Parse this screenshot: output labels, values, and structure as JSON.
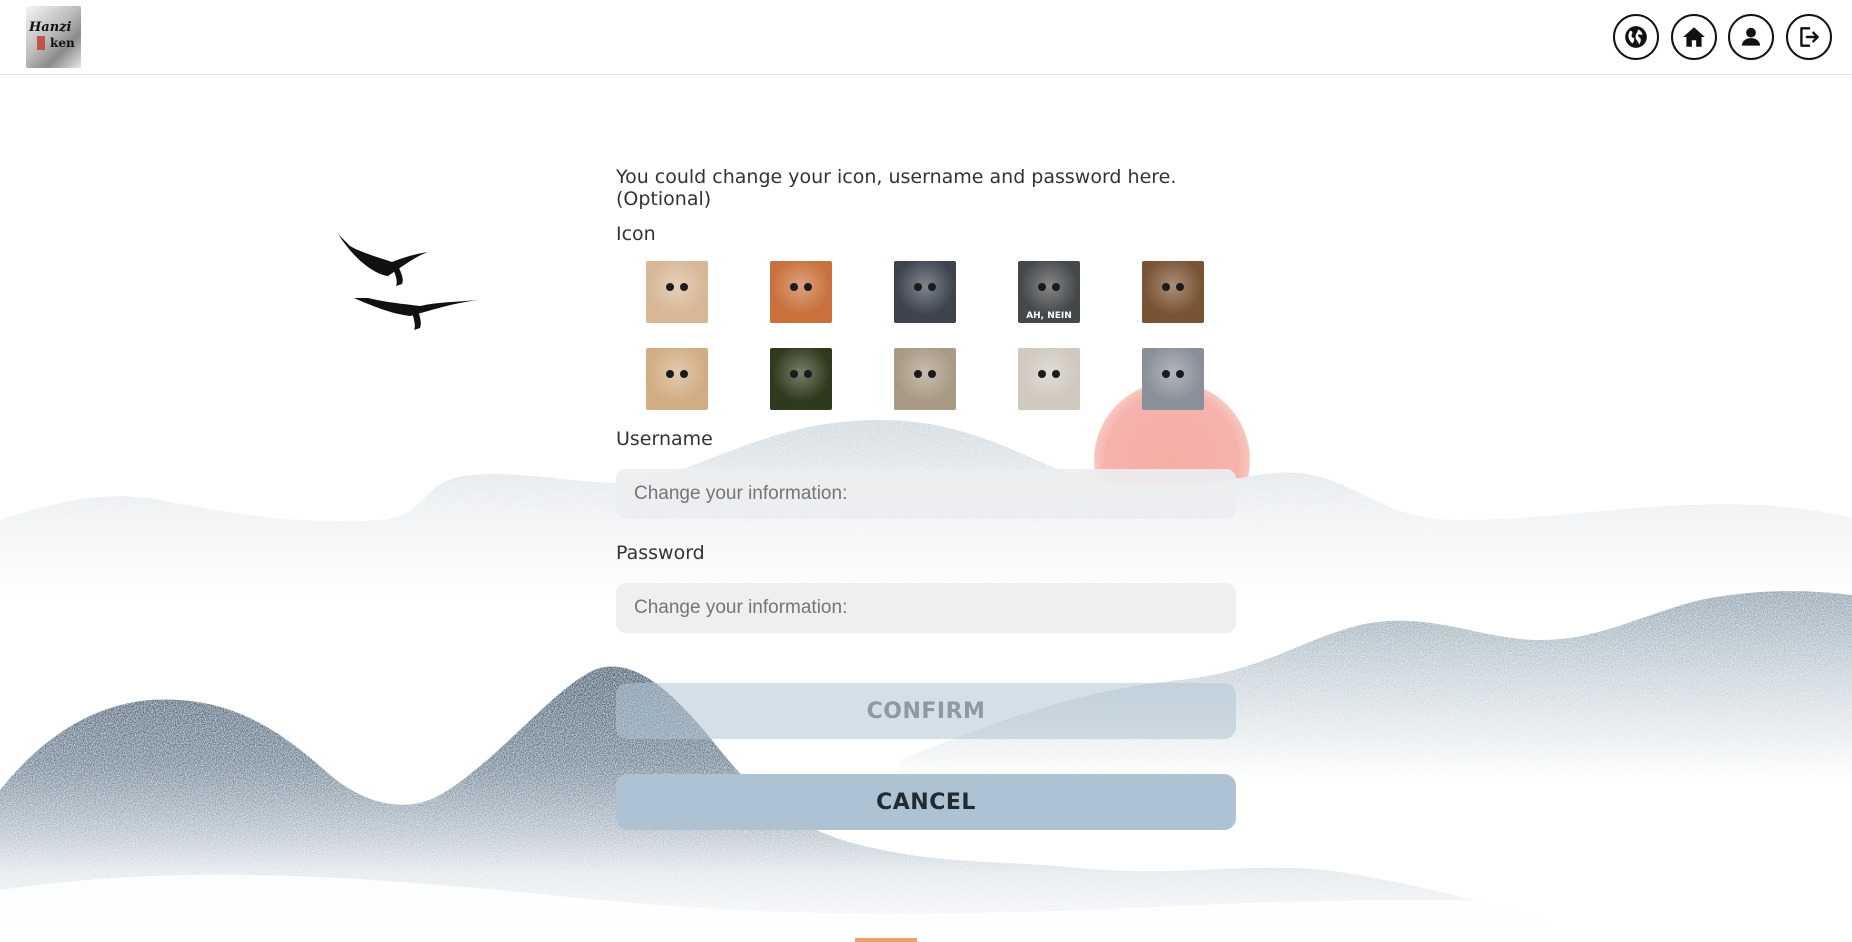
{
  "header": {
    "logo": {
      "name": "hanzi-ken-logo",
      "text_line1": "Hanzi",
      "text_line2": "ken"
    },
    "nav_icons": [
      "globe-icon",
      "home-icon",
      "user-icon",
      "logout-icon"
    ]
  },
  "form": {
    "intro": "You could change your icon, username and password here. (Optional)",
    "icon_label": "Icon",
    "icons": [
      {
        "name": "shiba-dog-avatar",
        "bg": "#d7b796",
        "caption": ""
      },
      {
        "name": "mustache-cat-avatar",
        "bg": "#c9703c",
        "caption": ""
      },
      {
        "name": "seal-avatar",
        "bg": "#3d4450",
        "caption": ""
      },
      {
        "name": "ostrich-avatar",
        "bg": "#45484a",
        "caption": "AH, NEIN"
      },
      {
        "name": "highland-cow-avatar",
        "bg": "#7a5334",
        "caption": ""
      },
      {
        "name": "dog-avatar",
        "bg": "#d2ad84",
        "caption": ""
      },
      {
        "name": "monkey-avatar",
        "bg": "#2f3a1d",
        "caption": ""
      },
      {
        "name": "smiling-seal-avatar",
        "bg": "#a99a85",
        "caption": ""
      },
      {
        "name": "llama-avatar",
        "bg": "#cfc9bf",
        "caption": ""
      },
      {
        "name": "bear-avatar",
        "bg": "#8a9099",
        "caption": ""
      }
    ],
    "username_label": "Username",
    "username_placeholder": "Change your information:",
    "password_label": "Password",
    "password_placeholder": "Change your information:",
    "confirm_label": "CONFIRM",
    "cancel_label": "CANCEL"
  },
  "colors": {
    "sun": "#f4a39b",
    "mountain_dark": "#4d6a80",
    "mountain_light": "#d4dde3",
    "accent": "#f0a060"
  }
}
